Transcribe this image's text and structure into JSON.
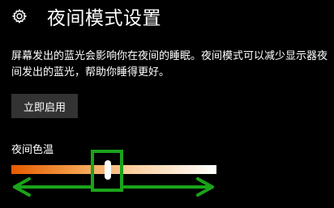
{
  "header": {
    "icon": "gear-icon",
    "title": "夜间模式设置"
  },
  "description": "屏幕发出的蓝光会影响你在夜间的睡眠。夜间模式可以减少显示器夜间发出的蓝光，帮助你睡得更好。",
  "enable_button": {
    "label": "立即启用"
  },
  "color_temp": {
    "label": "夜间色温",
    "value_fraction": 0.47,
    "gradient": [
      "#e65a00",
      "#f39b45",
      "#fbd0a2",
      "#ffffff"
    ]
  },
  "annotation": {
    "color": "#1aa31a"
  }
}
